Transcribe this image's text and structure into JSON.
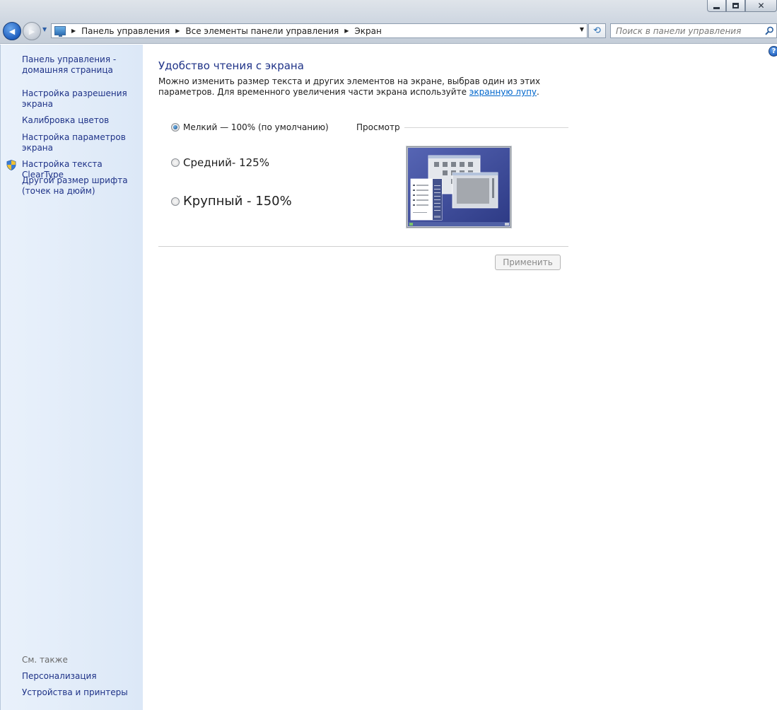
{
  "window": {
    "caption_buttons": {
      "minimize_icon": "minimize-icon",
      "maximize_icon": "maximize-icon",
      "close_glyph": "✕"
    }
  },
  "navigation": {
    "back_glyph": "◀",
    "forward_glyph": "▶",
    "breadcrumb": [
      "Панель управления",
      "Все элементы панели управления",
      "Экран"
    ],
    "separator": "▶",
    "dropdown_glyph": "▼",
    "refresh_glyph": "⟲"
  },
  "search": {
    "placeholder": "Поиск в панели управления"
  },
  "sidebar": {
    "items": [
      {
        "label": "Панель управления - домашняя страница"
      },
      {
        "label": "Настройка разрешения экрана"
      },
      {
        "label": "Калибровка цветов",
        "icon": "shield-icon"
      },
      {
        "label": "Настройка параметров экрана"
      },
      {
        "label": "Настройка текста ClearType"
      },
      {
        "label": "Другой размер шрифта (точек на дюйм)"
      }
    ],
    "see_also_heading": "См. также",
    "see_also": [
      {
        "label": "Персонализация"
      },
      {
        "label": "Устройства и принтеры"
      }
    ]
  },
  "main": {
    "help_glyph": "?",
    "title": "Удобство чтения с экрана",
    "description_text": "Можно изменить размер текста и других элементов на экране, выбрав один из этих параметров. Для временного увеличения части экрана используйте",
    "description_link": "экранную лупу",
    "description_end": ".",
    "options": [
      {
        "label": "Мелкий — 100% (по умолчанию)",
        "checked": true
      },
      {
        "label": "Средний- 125%",
        "checked": false
      },
      {
        "label": "Крупный - 150%",
        "checked": false
      }
    ],
    "preview_label": "Просмотр",
    "apply_label": "Применить"
  }
}
